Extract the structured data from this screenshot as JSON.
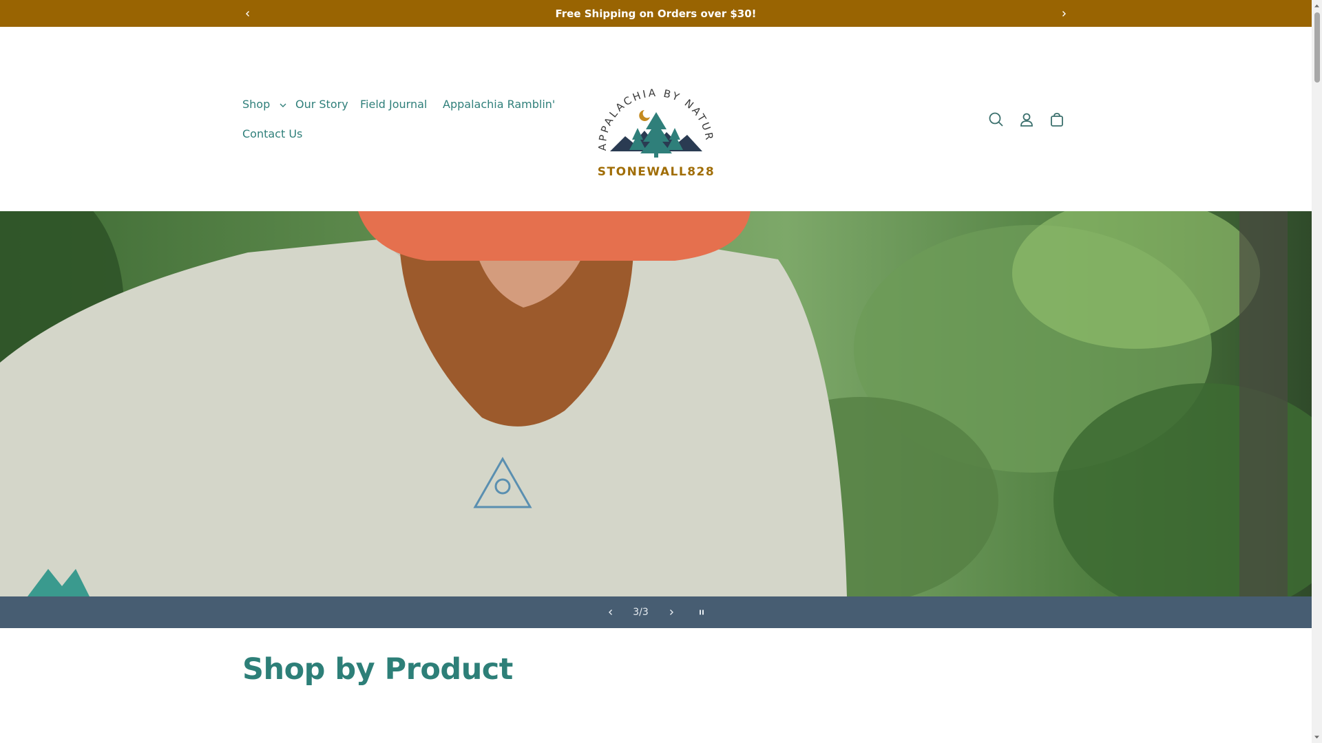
{
  "announcement": {
    "text": "Free Shipping on Orders over $30!",
    "prev_icon": "chevron-left-icon",
    "next_icon": "chevron-right-icon"
  },
  "nav": {
    "items": [
      {
        "label": "Shop",
        "has_dropdown": true
      },
      {
        "label": "Our Story"
      },
      {
        "label": "Field Journal"
      },
      {
        "label": "Appalachia Ramblin'"
      },
      {
        "label": "Contact Us"
      }
    ]
  },
  "logo": {
    "arc_text": "APPALACHIA BY NATURE",
    "brand": "STONEWALL828",
    "colors": {
      "arc": "#3b3b3b",
      "moon": "#c48a1f",
      "trees": "#2f7f7a",
      "brand": "#a06d06"
    }
  },
  "header_icons": [
    "search-icon",
    "account-icon",
    "cart-icon"
  ],
  "slideshow": {
    "counter": "3/3",
    "current": 3,
    "total": 3
  },
  "sections": {
    "shop_by_product_title": "Shop by Product"
  },
  "colors": {
    "announcement_bg": "#996402",
    "nav_text": "#2f7f7a",
    "slider_bar": "#475d72",
    "heading": "#2d7f78"
  }
}
